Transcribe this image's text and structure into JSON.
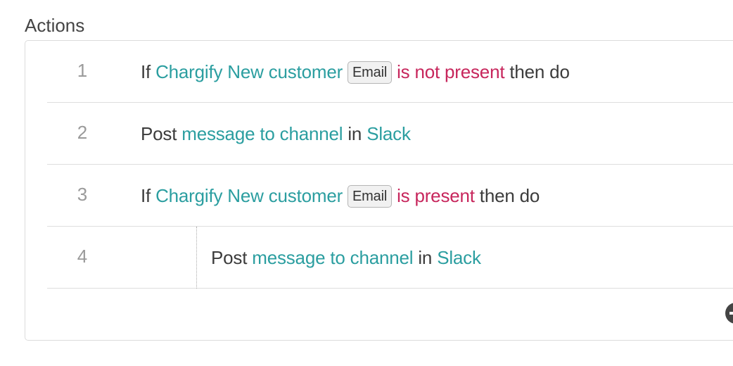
{
  "section": {
    "title": "Actions"
  },
  "actions": [
    {
      "number": "1",
      "parts": {
        "keyword": "If",
        "app": "Chargify",
        "trigger": "New customer",
        "field": "Email",
        "condition": "is not present",
        "suffix": "then do"
      }
    },
    {
      "number": "2",
      "parts": {
        "verb": "Post",
        "object": "message to channel",
        "prep": "in",
        "app": "Slack"
      }
    },
    {
      "number": "3",
      "parts": {
        "keyword": "If",
        "app": "Chargify",
        "trigger": "New customer",
        "field": "Email",
        "condition": "is present",
        "suffix": "then do"
      }
    },
    {
      "number": "4",
      "parts": {
        "verb": "Post",
        "object": "message to channel",
        "prep": "in",
        "app": "Slack"
      }
    }
  ],
  "icons": {
    "add_action": "plus-circle-icon"
  },
  "colors": {
    "link": "#2b9ea0",
    "condition": "#c7265c",
    "text": "#3c3c3c",
    "row_number": "#9a9a9a"
  }
}
